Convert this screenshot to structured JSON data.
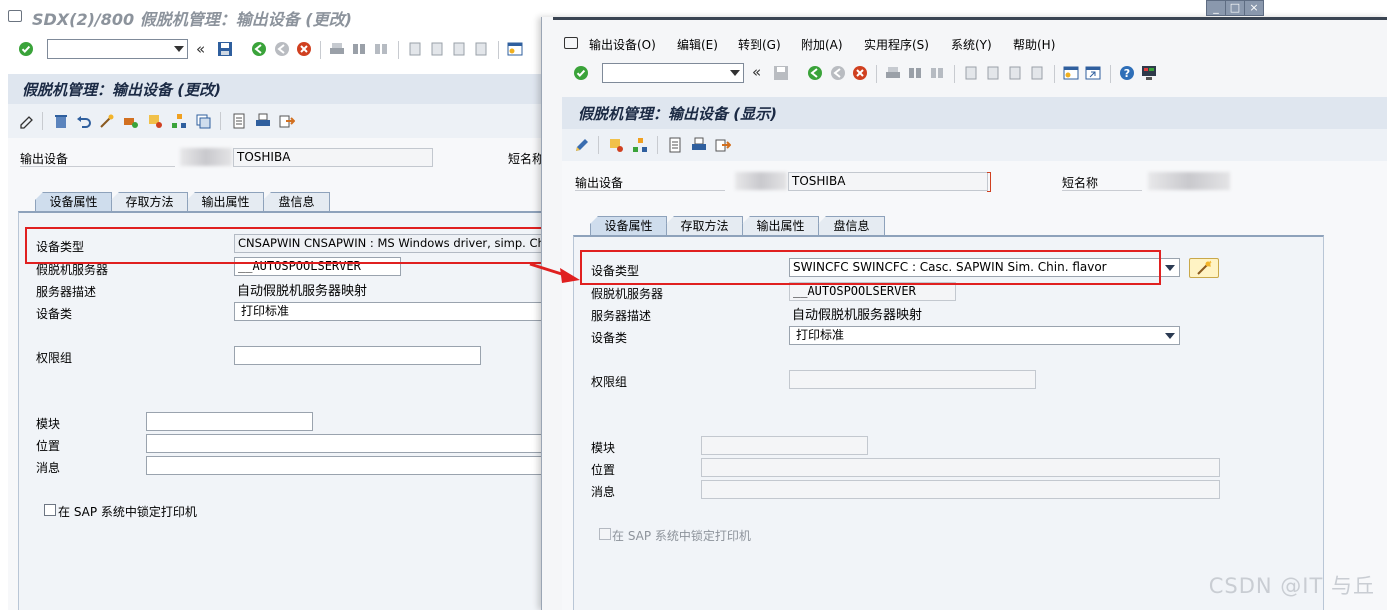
{
  "left_window": {
    "title": "SDX(2)/800 假脱机管理：输出设备 (更改)",
    "header": "假脱机管理：输出设备 (更改)",
    "output_device_label": "输出设备",
    "output_device_value": "TOSHIBA",
    "short_name_label": "短名称",
    "tabs": [
      "设备属性",
      "存取方法",
      "输出属性",
      "盘信息"
    ],
    "fields": {
      "device_type_label": "设备类型",
      "device_type_value": "CNSAPWIN CNSAPWIN : MS Windows driver, simp. Chin",
      "spool_server_label": "假脱机服务器",
      "spool_server_value": "__AUTOSPOOLSERVER",
      "server_desc_label": "服务器描述",
      "server_desc_value": "自动假脱机服务器映射",
      "device_class_label": "设备类",
      "device_class_value": "打印标准",
      "auth_group_label": "权限组",
      "auth_group_value": "",
      "model_label": "模块",
      "model_value": "",
      "location_label": "位置",
      "location_value": "",
      "message_label": "消息",
      "message_value": "",
      "lock_printer_label": "在 SAP 系统中锁定打印机"
    }
  },
  "right_window": {
    "menu": [
      "输出设备(O)",
      "编辑(E)",
      "转到(G)",
      "附加(A)",
      "实用程序(S)",
      "系统(Y)",
      "帮助(H)"
    ],
    "header": "假脱机管理：输出设备 (显示)",
    "output_device_label": "输出设备",
    "output_device_value": "TOSHIBA",
    "short_name_label": "短名称",
    "tabs": [
      "设备属性",
      "存取方法",
      "输出属性",
      "盘信息"
    ],
    "fields": {
      "device_type_label": "设备类型",
      "device_type_value": "SWINCFC SWINCFC  : Casc. SAPWIN Sim. Chin. flavor",
      "spool_server_label": "假脱机服务器",
      "spool_server_value": "__AUTOSPOOLSERVER",
      "server_desc_label": "服务器描述",
      "server_desc_value": "自动假脱机服务器映射",
      "device_class_label": "设备类",
      "device_class_value": "打印标准",
      "auth_group_label": "权限组",
      "auth_group_value": "",
      "model_label": "模块",
      "model_value": "",
      "location_label": "位置",
      "location_value": "",
      "message_label": "消息",
      "message_value": "",
      "lock_printer_label": "在 SAP 系统中锁定打印机"
    }
  },
  "watermark": "CSDN @IT 与丘",
  "colors": {
    "header_bg": "#dfe6ef",
    "highlight": "#e02020",
    "tab_active": "#cfdded",
    "tab_border": "#8ea2bb",
    "accept_green": "#3aa33a",
    "cancel_red": "#d04020"
  },
  "icons": {
    "accept": "check-circle-icon",
    "back": "back-arrow-icon",
    "exit": "exit-icon",
    "cancel": "cancel-icon",
    "save": "save-icon",
    "help": "help-icon",
    "display_change": "pencil-icon"
  }
}
